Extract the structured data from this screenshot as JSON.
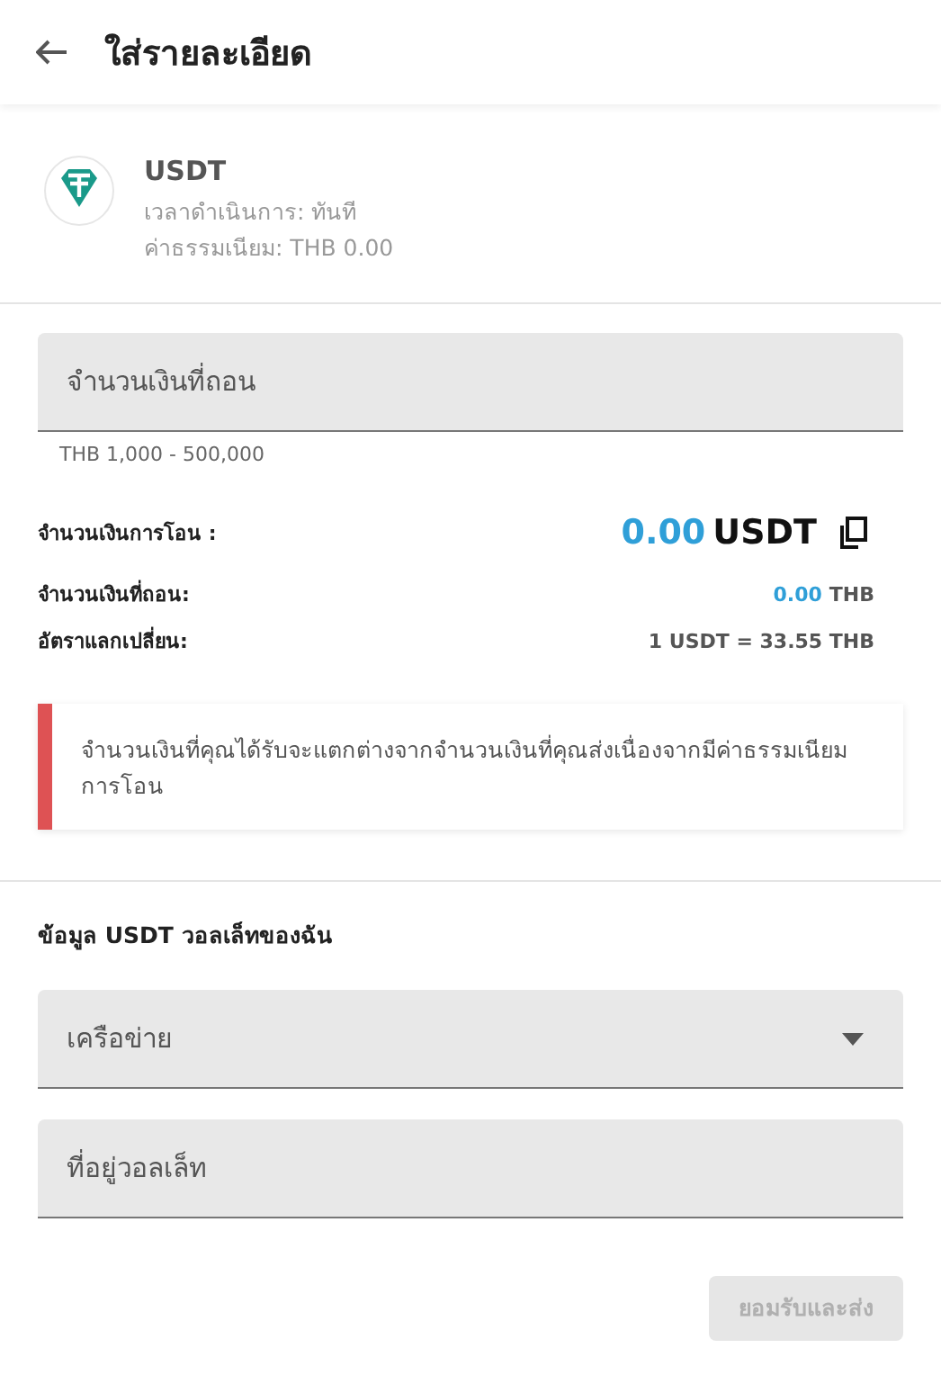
{
  "header": {
    "title": "ใส่รายละเอียด"
  },
  "coin": {
    "name": "USDT",
    "processing_time": "เวลาดำเนินการ: ทันที",
    "fee": "ค่าธรรมเนียม: THB 0.00"
  },
  "amount_field": {
    "placeholder": "จำนวนเงินที่ถอน",
    "hint": "THB 1,000 - 500,000"
  },
  "transfer": {
    "label": "จำนวนเงินการโอน :",
    "value": "0.00",
    "unit": "USDT"
  },
  "withdraw": {
    "label": "จำนวนเงินที่ถอน:",
    "value": "0.00",
    "unit": "THB"
  },
  "rate": {
    "label": "อัตราแลกเปลี่ยน:",
    "value": "1 USDT = 33.55 THB"
  },
  "notice": {
    "text": "จำนวนเงินที่คุณได้รับจะแตกต่างจากจำนวนเงินที่คุณส่งเนื่องจากมีค่าธรรมเนียมการโอน"
  },
  "wallet": {
    "heading": "ข้อมูล USDT วอลเล็ทของฉัน",
    "network_field": {
      "placeholder": "เครือข่าย"
    },
    "address_field": {
      "placeholder": "ที่อยู่วอลเล็ท"
    }
  },
  "submit": {
    "label": "ยอมรับและส่ง",
    "disabled": true
  }
}
